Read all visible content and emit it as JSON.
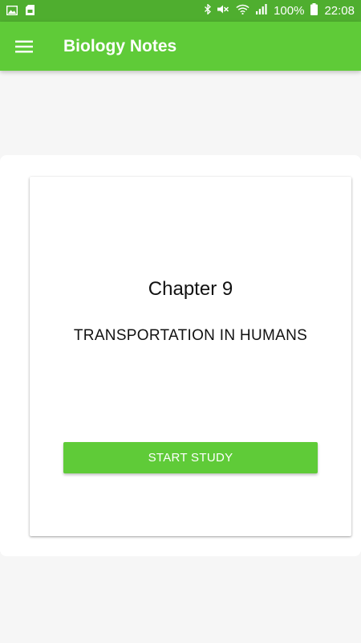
{
  "status_bar": {
    "battery_percent": "100%",
    "time": "22:08",
    "icons": [
      "gallery-icon",
      "sd-card-icon",
      "bluetooth-icon",
      "mute-icon",
      "wifi-icon",
      "signal-icon",
      "battery-icon"
    ]
  },
  "app_bar": {
    "title": "Biology Notes",
    "menu_icon": "hamburger-menu-icon"
  },
  "card": {
    "chapter": "Chapter 9",
    "subtitle": "TRANSPORTATION IN HUMANS",
    "button_label": "START STUDY"
  },
  "colors": {
    "status_bar": "#4fae2f",
    "app_bar": "#5fcb38",
    "accent": "#5fcb38",
    "background": "#f6f6f6"
  }
}
